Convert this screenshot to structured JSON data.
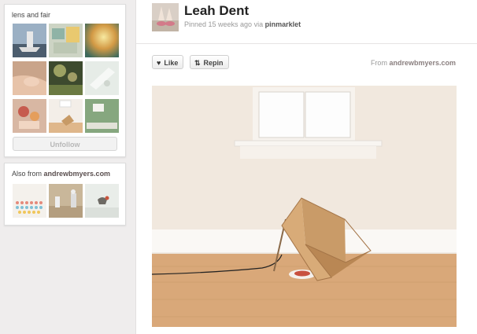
{
  "board_card": {
    "title": "lens and fair",
    "thumbnails": [
      "sailboat-photo",
      "collage-photo",
      "sunlight-photo",
      "arm-photo",
      "bokeh-photo",
      "white-room-photo",
      "hands-photo",
      "cardboard-photo",
      "green-room-photo"
    ],
    "unfollow_label": "Unfollow"
  },
  "also_from": {
    "prefix": "Also from",
    "site": "andrewbmyers.com",
    "thumbnails": [
      "pills-photo",
      "toys-photo",
      "bird-photo"
    ]
  },
  "pin": {
    "user_name": "Leah Dent",
    "pinned_text": "Pinned 15 weeks ago via",
    "via": "pinmarklet",
    "like_label": "Like",
    "repin_label": "Repin",
    "from_prefix": "From",
    "from_site": "andrewbmyers.com"
  }
}
